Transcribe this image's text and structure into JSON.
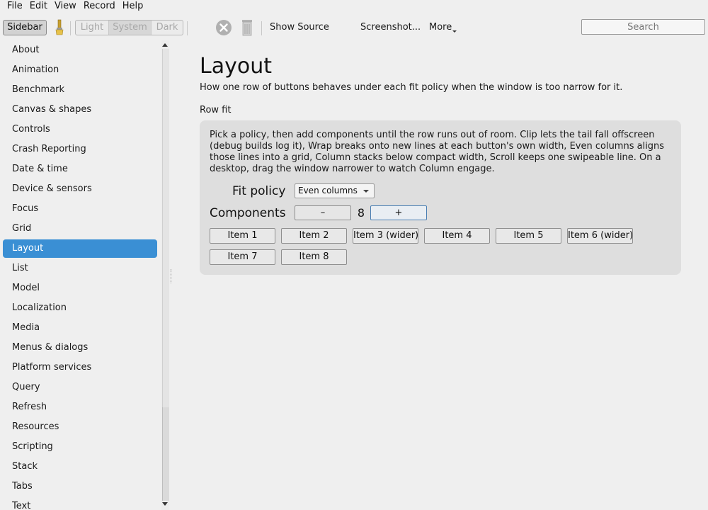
{
  "menu": [
    "File",
    "Edit",
    "View",
    "Record",
    "Help"
  ],
  "toolbar": {
    "sidebar_label": "Sidebar",
    "theme_modes": [
      "Light",
      "System",
      "Dark"
    ],
    "show_source_label": "Show Source",
    "screenshot_label": "Screenshot...",
    "more_label": "More",
    "search_placeholder": "Search",
    "icons": [
      "paintbrush-icon",
      "stop-icon",
      "trash-icon"
    ]
  },
  "sidebar": {
    "selected": "Layout",
    "items": [
      "About",
      "Animation",
      "Benchmark",
      "Canvas & shapes",
      "Controls",
      "Crash Reporting",
      "Date & time",
      "Device & sensors",
      "Focus",
      "Grid",
      "Layout",
      "List",
      "Model",
      "Localization",
      "Media",
      "Menus & dialogs",
      "Platform services",
      "Query",
      "Refresh",
      "Resources",
      "Scripting",
      "Stack",
      "Tabs",
      "Text"
    ]
  },
  "main": {
    "title": "Layout",
    "subtitle": "How one row of buttons behaves under each fit policy when the window is too narrow for it.",
    "section_label": "Row fit",
    "description": "Pick a policy, then add components until the row runs out of room. Clip lets the tail fall offscreen (debug builds log it), Wrap breaks onto new lines at each button's own width, Even columns aligns those lines into a grid, Column stacks below compact width, Scroll keeps one swipeable line. On a desktop, drag the window narrower to watch Column engage.",
    "fit_policy_label": "Fit policy",
    "fit_policy_value": "Even columns",
    "components_label": "Components",
    "minus_label": "–",
    "plus_label": "+",
    "component_count": "8",
    "items": [
      "Item 1",
      "Item 2",
      "Item 3 (wider)",
      "Item 4",
      "Item 5",
      "Item 6 (wider)",
      "Item 7",
      "Item 8"
    ]
  },
  "colors": {
    "selection": "#3a8fd4",
    "card_background": "#dedede",
    "window_background": "#efefef"
  }
}
